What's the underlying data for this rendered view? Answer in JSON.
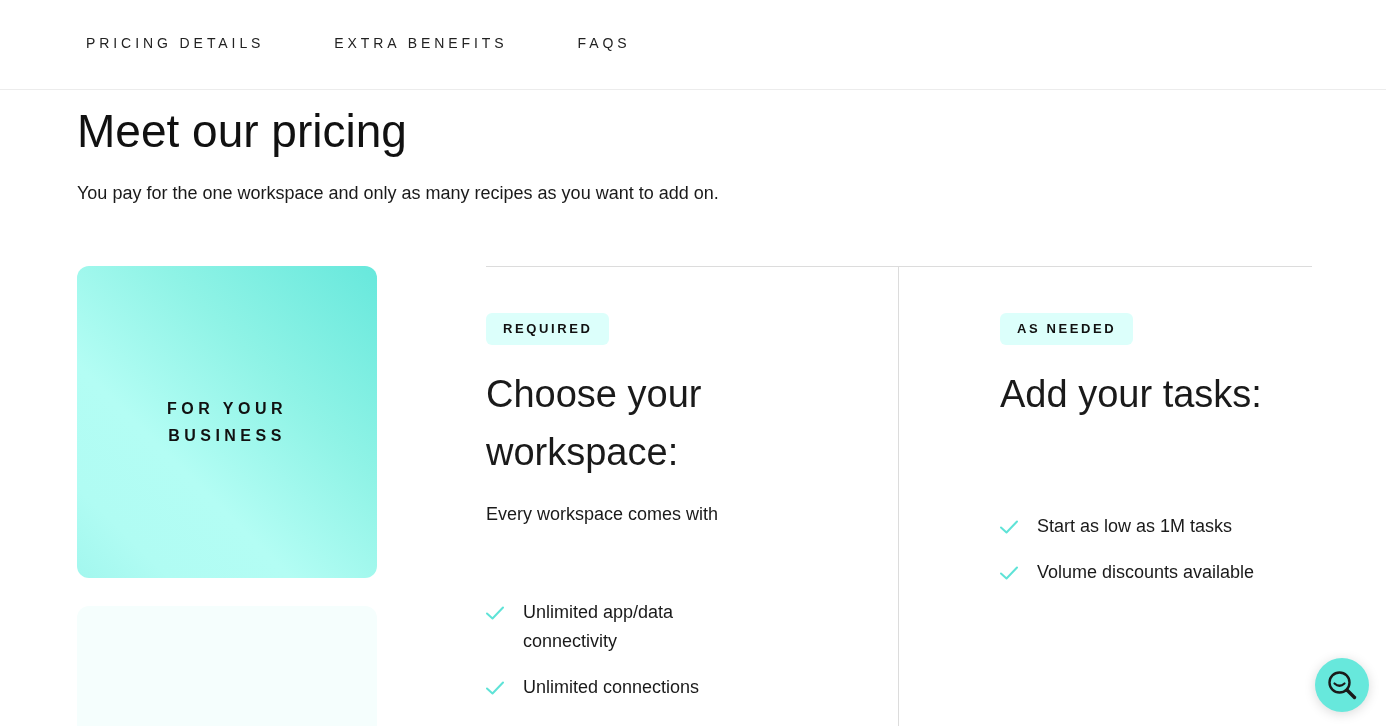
{
  "nav": {
    "links": [
      {
        "label": "PRICING DETAILS"
      },
      {
        "label": "EXTRA BENEFITS"
      },
      {
        "label": "FAQS"
      }
    ]
  },
  "header": {
    "title": "Meet our pricing",
    "subtitle": "You pay for the one workspace and only as many recipes as you want to add on."
  },
  "segments": [
    {
      "label": "FOR YOUR BUSINESS",
      "selected": true
    },
    {
      "selected": false
    }
  ],
  "columns": [
    {
      "badge": "REQUIRED",
      "title": "Choose your workspace:",
      "description": "Every workspace comes with",
      "features": [
        "Unlimited app/data connectivity",
        "Unlimited connections"
      ]
    },
    {
      "badge": "AS NEEDED",
      "title": "Add your tasks:",
      "features": [
        "Start as low as 1M tasks",
        "Volume discounts available"
      ]
    }
  ]
}
